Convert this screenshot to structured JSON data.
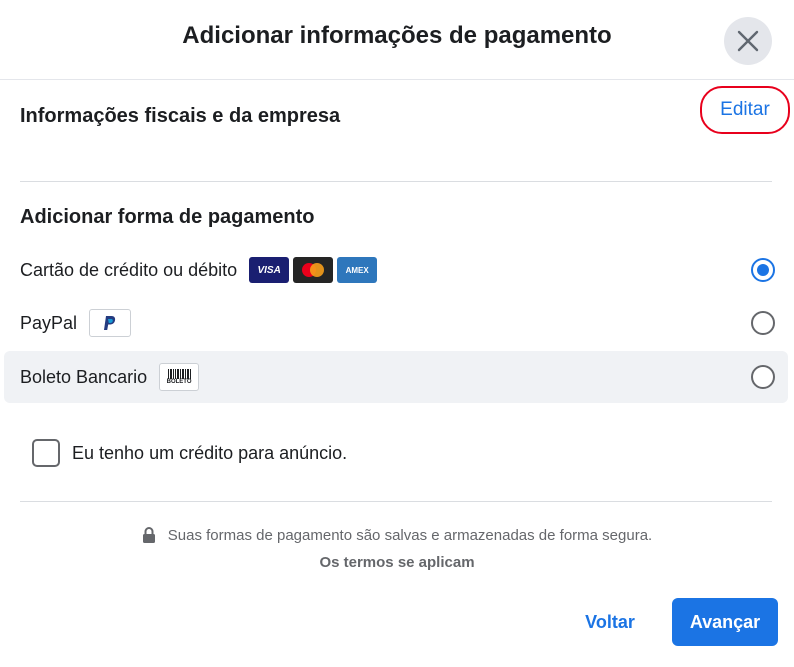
{
  "dialog": {
    "title": "Adicionar informações de pagamento",
    "close_icon": "close-icon"
  },
  "tax_section": {
    "title": "Informações fiscais e da empresa",
    "edit_label": "Editar",
    "edit_highlight_color": "#e8001c"
  },
  "payment_section": {
    "title": "Adicionar forma de pagamento",
    "options": [
      {
        "label": "Cartão de crédito ou débito",
        "selected": true,
        "logos": [
          "VISA",
          "mastercard",
          "AMEX"
        ]
      },
      {
        "label": "PayPal",
        "selected": false,
        "logos": [
          "P"
        ]
      },
      {
        "label": "Boleto Bancario",
        "selected": false,
        "logos": [
          "BOLETO"
        ]
      }
    ]
  },
  "ad_credit": {
    "label": "Eu tenho um crédito para anúncio.",
    "checked": false
  },
  "footer": {
    "secure_note": "Suas formas de pagamento são salvas e armazenadas de forma segura.",
    "terms": "Os termos se aplicam",
    "back_label": "Voltar",
    "next_label": "Avançar"
  },
  "colors": {
    "accent": "#1b74e4",
    "text": "#1c1e21",
    "secondary_text": "#65676b"
  }
}
